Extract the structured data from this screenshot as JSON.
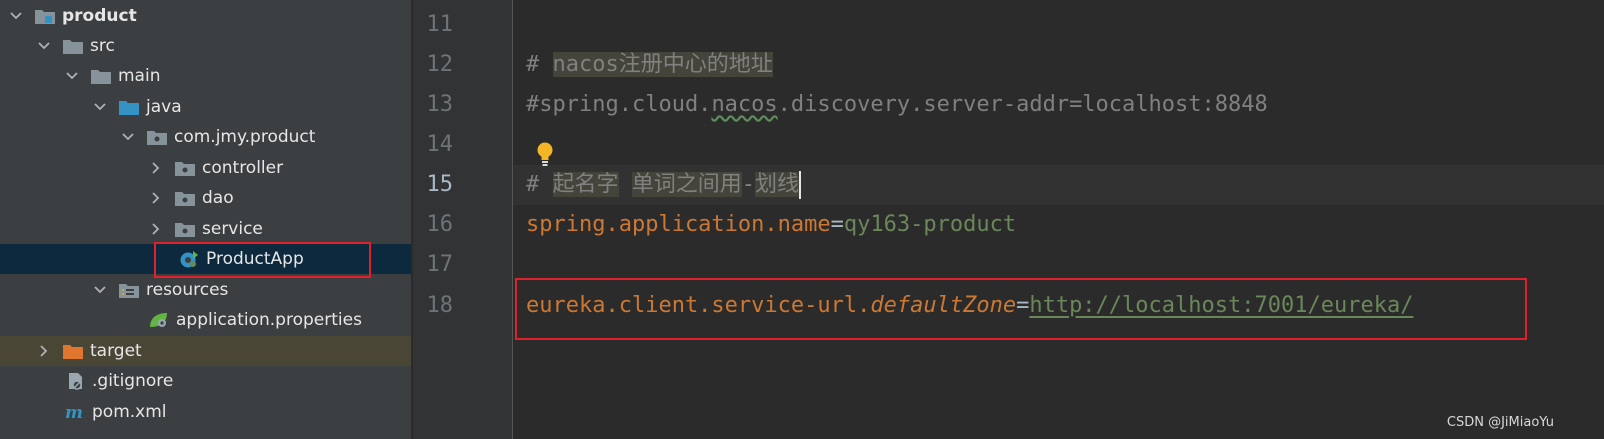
{
  "project_tree": {
    "items": [
      {
        "label": "product",
        "icon": "module-folder-icon",
        "expanded": true
      },
      {
        "label": "src",
        "icon": "folder-icon",
        "expanded": true
      },
      {
        "label": "main",
        "icon": "folder-icon",
        "expanded": true
      },
      {
        "label": "java",
        "icon": "source-root-folder-icon",
        "expanded": true
      },
      {
        "label": "com.jmy.product",
        "icon": "package-icon",
        "expanded": true
      },
      {
        "label": "controller",
        "icon": "package-icon",
        "expanded": false
      },
      {
        "label": "dao",
        "icon": "package-icon",
        "expanded": false
      },
      {
        "label": "service",
        "icon": "package-icon",
        "expanded": false
      },
      {
        "label": "ProductApp",
        "icon": "spring-boot-class-icon",
        "selected": true
      },
      {
        "label": "resources",
        "icon": "resources-folder-icon",
        "expanded": true
      },
      {
        "label": "application.properties",
        "icon": "spring-properties-icon"
      },
      {
        "label": "target",
        "icon": "excluded-folder-icon",
        "expanded": false
      },
      {
        "label": ".gitignore",
        "icon": "ignore-file-icon"
      },
      {
        "label": "pom.xml",
        "icon": "maven-icon"
      }
    ]
  },
  "editor": {
    "line_numbers": [
      "11",
      "12",
      "13",
      "14",
      "15",
      "16",
      "17",
      "18"
    ],
    "current_line": "15",
    "lines": {
      "l12": {
        "prefix": "# ",
        "word": "nacos",
        "cjk": "注册中心的地址"
      },
      "l13": {
        "a": "#spring.cloud.",
        "b": "nacos",
        "c": ".discovery.server-addr=localhost:8848"
      },
      "l15": {
        "a": "# ",
        "b": "起名字",
        "c": " ",
        "d": "单词之间用",
        "e": "-",
        "f": "划线"
      },
      "l16": {
        "key": "spring.application.name",
        "eq": "=",
        "value": "qy163-product"
      },
      "l18": {
        "key": "eureka.client.service-url.",
        "key_italic": "defaultZone",
        "eq": "=",
        "value": "http://localhost:7001/eureka/"
      }
    }
  },
  "watermark": "CSDN @JiMiaoYu",
  "colors": {
    "tree_bg": "#3c3f41",
    "editor_bg": "#2b2b2b",
    "keyword_orange": "#cc7832",
    "string_green": "#6a8759",
    "comment_gray": "#808080",
    "annotation_red": "#e0202a"
  }
}
